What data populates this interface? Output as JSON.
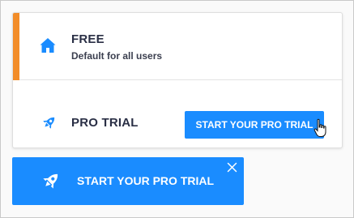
{
  "plans": {
    "free": {
      "icon": "home-icon",
      "title": "FREE",
      "subtitle": "Default for all users",
      "accent_color": "#f28c28"
    },
    "pro_trial": {
      "icon": "rocket-icon",
      "title": "PRO TRIAL",
      "button_label": "START YOUR PRO TRIAL"
    }
  },
  "banner": {
    "icon": "rocket-icon",
    "label": "START YOUR PRO TRIAL",
    "close_icon": "close-icon"
  },
  "colors": {
    "primary": "#1a8cff",
    "title_text": "#2a2f45",
    "accent": "#f28c28"
  }
}
